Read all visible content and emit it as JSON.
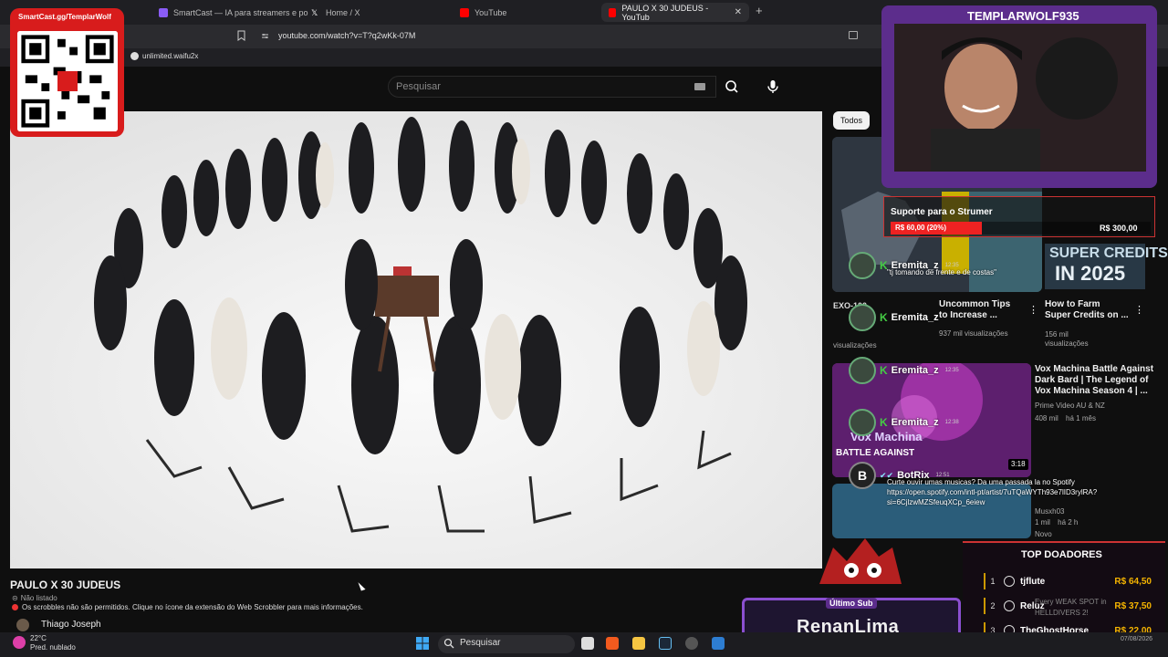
{
  "browser": {
    "tabs": [
      {
        "label": "SmartCast — IA para streamers e po",
        "icon_color": "#8a5cf6"
      },
      {
        "label": "Home / X",
        "icon_color": "#ffffff"
      },
      {
        "label": "YouTube",
        "icon_color": "#ff0000"
      },
      {
        "label": "PAULO X 30 JUDEUS - YouTub",
        "icon_color": "#ff0000",
        "active": true
      }
    ],
    "url": "youtube.com/watch?v=T?q2wKk-07M",
    "bookmark": "unlimited.waifu2x"
  },
  "youtube": {
    "search_placeholder": "Pesquisar",
    "video_title": "PAULO X 30 JUDEUS",
    "visibility": "Não listado",
    "scrobbler_notice": "Os scrobbles não são permitidos. Clique no ícone da extensão do Web Scrobbler para mais informações.",
    "channel_name": "Thiago Joseph",
    "filter_chip": "Todos",
    "recommendations": [
      {
        "title_line1": "Uncommon Tips",
        "title_line2": "to Increase ...",
        "views": "937 mil visualizações"
      },
      {
        "title_line1": "How to Farm",
        "title_line2": "Super Credits on ...",
        "meta1": "156 mil",
        "meta2": "visualizações"
      },
      {
        "title_line1": "Vox Machina Battle Against",
        "title_line2": "Dark Bard | The Legend of",
        "title_line3": "Vox Machina Season 4 | ...",
        "channel": "Prime Video AU & NZ",
        "views": "408 mil",
        "age": "há 1 mês"
      },
      {
        "channel": "Musxh03",
        "views": "1 mil",
        "age": "há 2 h",
        "badge": "Novo",
        "duration": "3:18"
      }
    ],
    "partial_labels": {
      "exo": "EXO-100",
      "views_left": "visualizações",
      "vox_overlay": "Vox Machina",
      "battle_overlay": "BATTLE AGAINST",
      "weak_spot": "Every WEAK SPOT in",
      "helldivers": "HELLDIVERS 2!"
    },
    "thumbnail_text": {
      "super_credits_1": "SUPER CREDITS",
      "super_credits_2": "IN 2025"
    }
  },
  "stream": {
    "qr_label": "SmartCast.gg/TemplarWolf",
    "streamer_name": "TEMPLARWOLF935",
    "support": {
      "title": "Suporte para o Strumer",
      "progress": "R$ 60,00 (20%)",
      "goal": "R$ 300,00",
      "progress_fraction": 0.2
    },
    "chat": [
      {
        "user": "Eremita_z",
        "time": "12:35",
        "message": "\"tj tomando de frente e de costas\""
      },
      {
        "user": "Eremita_z",
        "time": "12:35",
        "message": ""
      },
      {
        "user": "Eremita_z",
        "time": "12:35",
        "message": ""
      },
      {
        "user": "Eremita_z",
        "time": "12:38",
        "message": ""
      },
      {
        "user": "BotRix",
        "time": "12:51",
        "message_line1": "Curte ouvir umas musicas? Da uma passada la no Spotify",
        "message_line2": "https://open.spotify.com/intl-pt/artist/7uTQaWYTh93e7lID3rylRA?",
        "message_line3": "si=6CjlzwMZSfeuqXCp_6eiew"
      }
    ],
    "top_donors_title": "TOP DOADORES",
    "top_donors": [
      {
        "rank": "1",
        "name": "tjflute",
        "amount": "R$ 64,50"
      },
      {
        "rank": "2",
        "name": "Reluz",
        "amount": "R$ 37,50"
      },
      {
        "rank": "3",
        "name": "TheGhostHorse",
        "amount": "R$ 22,00"
      }
    ],
    "last_sub_label": "Último Sub",
    "last_sub_name": "RenanLima"
  },
  "taskbar": {
    "temperature": "22°C",
    "weather": "Pred. nublado",
    "search_label": "Pesquisar",
    "date": "07/08/2026"
  },
  "colors": {
    "accent_purple": "#5c2d8c",
    "accent_red": "#d81c1c",
    "youtube_bg": "#0f0f0f"
  }
}
